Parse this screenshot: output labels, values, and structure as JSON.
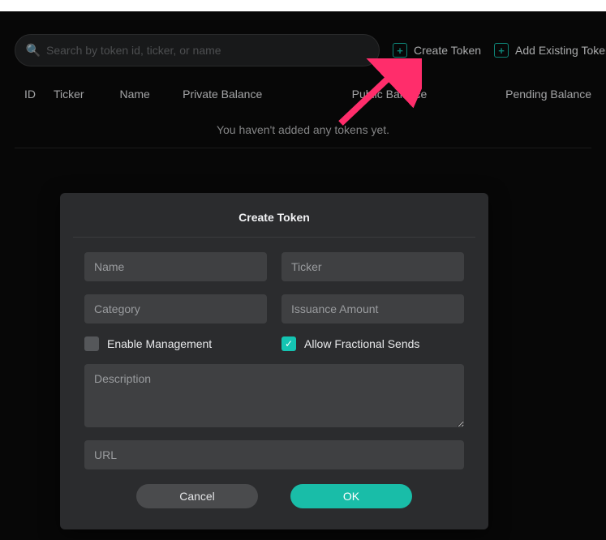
{
  "toolbar": {
    "search_placeholder": "Search by token id, ticker, or name",
    "create_label": "Create Token",
    "add_existing_label": "Add Existing Token"
  },
  "table": {
    "headers": {
      "id": "ID",
      "ticker": "Ticker",
      "name": "Name",
      "private_balance": "Private Balance",
      "public_balance": "Public Balance",
      "pending_balance": "Pending Balance"
    },
    "empty_message": "You haven't added any tokens yet."
  },
  "modal": {
    "title": "Create Token",
    "fields": {
      "name_placeholder": "Name",
      "ticker_placeholder": "Ticker",
      "category_placeholder": "Category",
      "issuance_placeholder": "Issuance Amount",
      "description_placeholder": "Description",
      "url_placeholder": "URL"
    },
    "checkboxes": {
      "enable_management_label": "Enable Management",
      "allow_fractional_label": "Allow Fractional Sends"
    },
    "buttons": {
      "cancel": "Cancel",
      "ok": "OK"
    }
  },
  "colors": {
    "accent": "#14b8a6",
    "bg_dark": "#0a0a0a",
    "panel": "#2b2c2e",
    "field": "#3f4042"
  }
}
